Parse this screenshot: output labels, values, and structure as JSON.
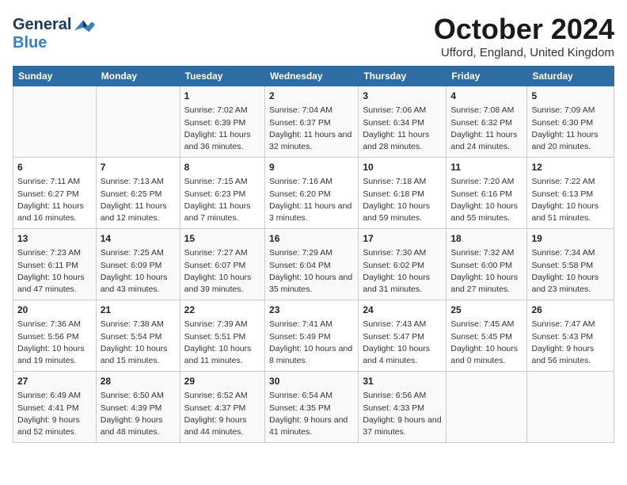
{
  "header": {
    "logo_general": "General",
    "logo_blue": "Blue",
    "month_title": "October 2024",
    "location": "Ufford, England, United Kingdom"
  },
  "days_of_week": [
    "Sunday",
    "Monday",
    "Tuesday",
    "Wednesday",
    "Thursday",
    "Friday",
    "Saturday"
  ],
  "weeks": [
    [
      {
        "day": "",
        "info": ""
      },
      {
        "day": "",
        "info": ""
      },
      {
        "day": "1",
        "info": "Sunrise: 7:02 AM\nSunset: 6:39 PM\nDaylight: 11 hours and 36 minutes."
      },
      {
        "day": "2",
        "info": "Sunrise: 7:04 AM\nSunset: 6:37 PM\nDaylight: 11 hours and 32 minutes."
      },
      {
        "day": "3",
        "info": "Sunrise: 7:06 AM\nSunset: 6:34 PM\nDaylight: 11 hours and 28 minutes."
      },
      {
        "day": "4",
        "info": "Sunrise: 7:08 AM\nSunset: 6:32 PM\nDaylight: 11 hours and 24 minutes."
      },
      {
        "day": "5",
        "info": "Sunrise: 7:09 AM\nSunset: 6:30 PM\nDaylight: 11 hours and 20 minutes."
      }
    ],
    [
      {
        "day": "6",
        "info": "Sunrise: 7:11 AM\nSunset: 6:27 PM\nDaylight: 11 hours and 16 minutes."
      },
      {
        "day": "7",
        "info": "Sunrise: 7:13 AM\nSunset: 6:25 PM\nDaylight: 11 hours and 12 minutes."
      },
      {
        "day": "8",
        "info": "Sunrise: 7:15 AM\nSunset: 6:23 PM\nDaylight: 11 hours and 7 minutes."
      },
      {
        "day": "9",
        "info": "Sunrise: 7:16 AM\nSunset: 6:20 PM\nDaylight: 11 hours and 3 minutes."
      },
      {
        "day": "10",
        "info": "Sunrise: 7:18 AM\nSunset: 6:18 PM\nDaylight: 10 hours and 59 minutes."
      },
      {
        "day": "11",
        "info": "Sunrise: 7:20 AM\nSunset: 6:16 PM\nDaylight: 10 hours and 55 minutes."
      },
      {
        "day": "12",
        "info": "Sunrise: 7:22 AM\nSunset: 6:13 PM\nDaylight: 10 hours and 51 minutes."
      }
    ],
    [
      {
        "day": "13",
        "info": "Sunrise: 7:23 AM\nSunset: 6:11 PM\nDaylight: 10 hours and 47 minutes."
      },
      {
        "day": "14",
        "info": "Sunrise: 7:25 AM\nSunset: 6:09 PM\nDaylight: 10 hours and 43 minutes."
      },
      {
        "day": "15",
        "info": "Sunrise: 7:27 AM\nSunset: 6:07 PM\nDaylight: 10 hours and 39 minutes."
      },
      {
        "day": "16",
        "info": "Sunrise: 7:29 AM\nSunset: 6:04 PM\nDaylight: 10 hours and 35 minutes."
      },
      {
        "day": "17",
        "info": "Sunrise: 7:30 AM\nSunset: 6:02 PM\nDaylight: 10 hours and 31 minutes."
      },
      {
        "day": "18",
        "info": "Sunrise: 7:32 AM\nSunset: 6:00 PM\nDaylight: 10 hours and 27 minutes."
      },
      {
        "day": "19",
        "info": "Sunrise: 7:34 AM\nSunset: 5:58 PM\nDaylight: 10 hours and 23 minutes."
      }
    ],
    [
      {
        "day": "20",
        "info": "Sunrise: 7:36 AM\nSunset: 5:56 PM\nDaylight: 10 hours and 19 minutes."
      },
      {
        "day": "21",
        "info": "Sunrise: 7:38 AM\nSunset: 5:54 PM\nDaylight: 10 hours and 15 minutes."
      },
      {
        "day": "22",
        "info": "Sunrise: 7:39 AM\nSunset: 5:51 PM\nDaylight: 10 hours and 11 minutes."
      },
      {
        "day": "23",
        "info": "Sunrise: 7:41 AM\nSunset: 5:49 PM\nDaylight: 10 hours and 8 minutes."
      },
      {
        "day": "24",
        "info": "Sunrise: 7:43 AM\nSunset: 5:47 PM\nDaylight: 10 hours and 4 minutes."
      },
      {
        "day": "25",
        "info": "Sunrise: 7:45 AM\nSunset: 5:45 PM\nDaylight: 10 hours and 0 minutes."
      },
      {
        "day": "26",
        "info": "Sunrise: 7:47 AM\nSunset: 5:43 PM\nDaylight: 9 hours and 56 minutes."
      }
    ],
    [
      {
        "day": "27",
        "info": "Sunrise: 6:49 AM\nSunset: 4:41 PM\nDaylight: 9 hours and 52 minutes."
      },
      {
        "day": "28",
        "info": "Sunrise: 6:50 AM\nSunset: 4:39 PM\nDaylight: 9 hours and 48 minutes."
      },
      {
        "day": "29",
        "info": "Sunrise: 6:52 AM\nSunset: 4:37 PM\nDaylight: 9 hours and 44 minutes."
      },
      {
        "day": "30",
        "info": "Sunrise: 6:54 AM\nSunset: 4:35 PM\nDaylight: 9 hours and 41 minutes."
      },
      {
        "day": "31",
        "info": "Sunrise: 6:56 AM\nSunset: 4:33 PM\nDaylight: 9 hours and 37 minutes."
      },
      {
        "day": "",
        "info": ""
      },
      {
        "day": "",
        "info": ""
      }
    ]
  ]
}
